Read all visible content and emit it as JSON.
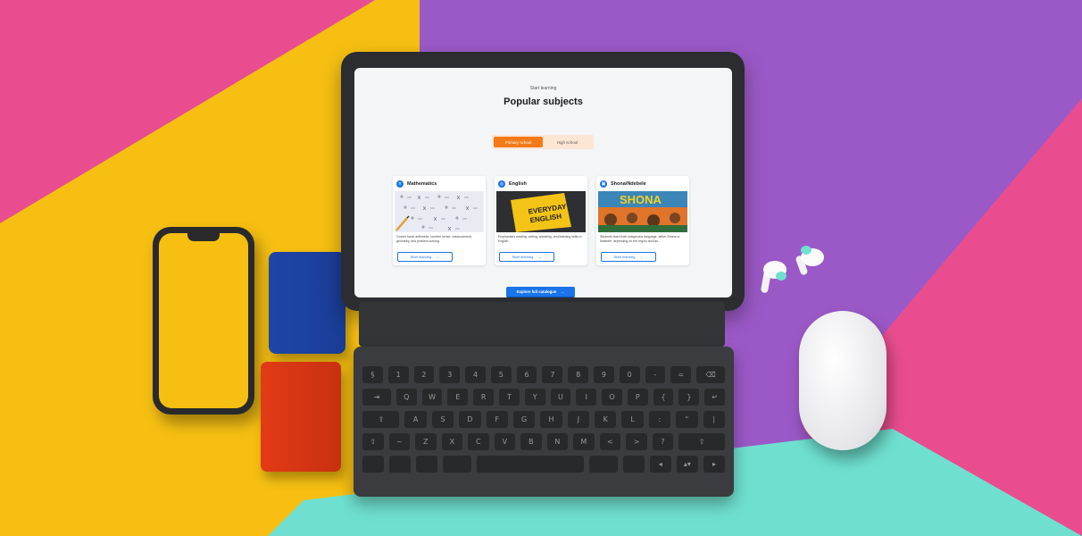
{
  "tablet_page": {
    "eyebrow": "Start learning",
    "title": "Popular subjects",
    "tabs": [
      {
        "label": "Primary school",
        "active": true
      },
      {
        "label": "High school",
        "active": false
      }
    ],
    "cards": [
      {
        "icon": "pi-icon",
        "icon_glyph": "π",
        "title": "Mathematics",
        "image": "math-worksheet-photo",
        "description": "Covers basic arithmetic, number sense, measurement, geometry, and problem-solving.",
        "button": "Start learning"
      },
      {
        "icon": "globe-icon",
        "icon_glyph": "◎",
        "title": "English",
        "image": "everyday-english-book-photo",
        "description": "Emphasises reading, writing, speaking, and listening skills in English.",
        "button": "Start learning"
      },
      {
        "icon": "book-icon",
        "icon_glyph": "▣",
        "title": "Shona/Ndebele",
        "image": "shona-poster-photo",
        "image_text": "SHONA",
        "description": "Students learn their indigenous language, either Shona or Ndebele, depending on the region and lan...",
        "button": "Start learning"
      }
    ],
    "explore_button": "Explore full catalogue"
  },
  "keyboard": {
    "rows": [
      [
        "§",
        "1",
        "2",
        "3",
        "4",
        "5",
        "6",
        "7",
        "8",
        "9",
        "0",
        "-",
        "=",
        "⌫"
      ],
      [
        "⇥",
        "Q",
        "W",
        "E",
        "R",
        "T",
        "Y",
        "U",
        "I",
        "O",
        "P",
        "{",
        "}",
        "↵"
      ],
      [
        "⇪",
        "A",
        "S",
        "D",
        "F",
        "G",
        "H",
        "J",
        "K",
        "L",
        ":",
        "\"",
        "|"
      ],
      [
        "⇧",
        "~",
        "Z",
        "X",
        "C",
        "V",
        "B",
        "N",
        "M",
        "<",
        ">",
        "?",
        "⇧"
      ],
      [
        "",
        "",
        "",
        "",
        "",
        "",
        "",
        "◂",
        "▴▾",
        "▸"
      ]
    ]
  },
  "colors": {
    "accent_orange": "#f47a18",
    "accent_blue": "#1a73e8",
    "bg_pink": "#e94d8f",
    "bg_purple": "#9b59c7",
    "bg_yellow": "#f6bf12",
    "bg_teal": "#6fe0cf"
  }
}
